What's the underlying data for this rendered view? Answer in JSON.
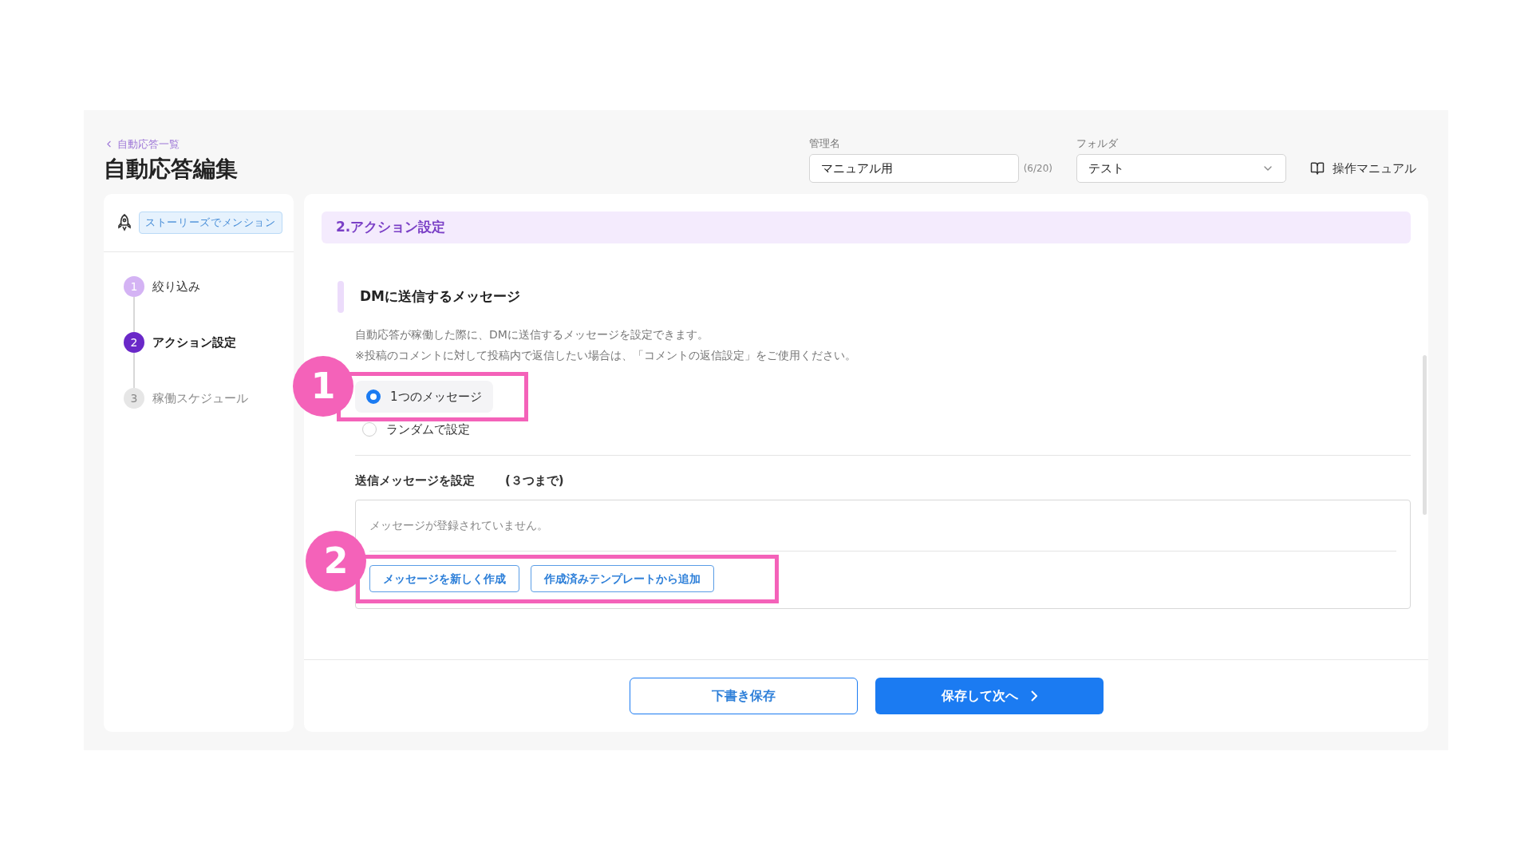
{
  "breadcrumb": {
    "label": "自動応答一覧"
  },
  "title": "自動応答編集",
  "name_field": {
    "label": "管理名",
    "value": "マニュアル用",
    "counter": "(6/20)"
  },
  "folder_field": {
    "label": "フォルダ",
    "value": "テスト"
  },
  "manual_link": {
    "label": "操作マニュアル"
  },
  "sidebar": {
    "trigger_tag": "ストーリーズでメンション",
    "steps": [
      {
        "number": "1",
        "label": "絞り込み",
        "completed": true,
        "selected": false
      },
      {
        "number": "2",
        "label": "アクション設定",
        "completed": false,
        "selected": true
      },
      {
        "number": "3",
        "label": "稼働スケジュール",
        "completed": false,
        "selected": false
      }
    ]
  },
  "section": {
    "title": "2.アクション設定",
    "subheading": "DMに送信するメッセージ",
    "description": [
      "自動応答が稼働した際に、DMに送信するメッセージを設定できます。",
      "※投稿のコメントに対して投稿内で返信したい場合は、「コメントの返信設定」をご使用ください。"
    ],
    "options": [
      {
        "label": "1つのメッセージ",
        "selected": true
      },
      {
        "label": "ランダムで設定",
        "selected": false
      }
    ],
    "messages": {
      "label": "送信メッセージを設定",
      "limit": "(３つまで)",
      "empty": "メッセージが登録されていません。",
      "buttons": [
        "メッセージを新しく作成",
        "作成済みテンプレートから追加"
      ]
    }
  },
  "footer_buttons": [
    {
      "label": "下書き保存",
      "kind": "secondary"
    },
    {
      "label": "保存して次へ",
      "kind": "primary"
    }
  ],
  "annotations": [
    "1",
    "2"
  ]
}
